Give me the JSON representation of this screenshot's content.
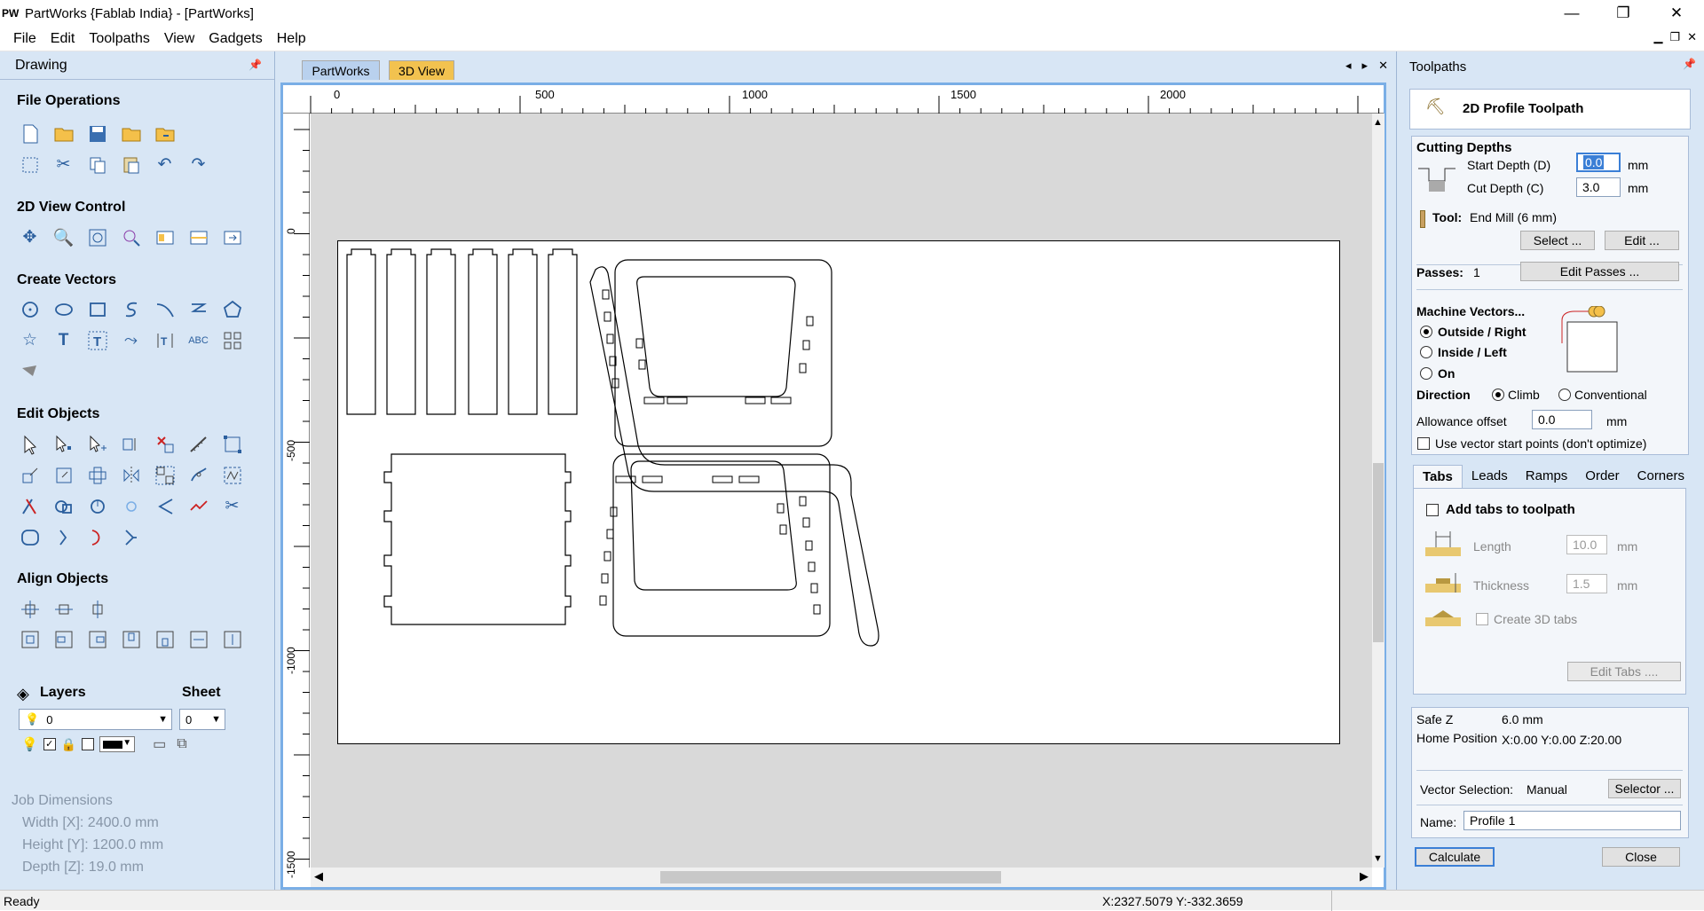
{
  "window": {
    "logo": "PW",
    "title": "PartWorks {Fablab India} - [PartWorks]",
    "minimize": "—",
    "restore": "❐",
    "close": "✕"
  },
  "menu": [
    "File",
    "Edit",
    "Toolpaths",
    "View",
    "Gadgets",
    "Help"
  ],
  "drawing_panel": {
    "title": "Drawing",
    "sections": {
      "file_ops": "File Operations",
      "view_control": "2D View Control",
      "create_vectors": "Create Vectors",
      "edit_objects": "Edit Objects",
      "align_objects": "Align Objects"
    },
    "layers_label": "Layers",
    "sheet_label": "Sheet",
    "layer_value": "0",
    "sheet_value": "0",
    "job_dimensions": {
      "title": "Job Dimensions",
      "width": "Width  [X]: 2400.0 mm",
      "height": "Height [Y]: 1200.0 mm",
      "depth": "Depth  [Z]: 19.0 mm"
    }
  },
  "document": {
    "tabs": [
      "PartWorks",
      "3D View"
    ],
    "hruler_labels": [
      "0",
      "500",
      "1000",
      "1500",
      "2000"
    ],
    "vruler_labels": [
      "0",
      "-500",
      "-1000",
      "-1500"
    ]
  },
  "toolpaths_panel": {
    "title": "Toolpaths",
    "header": "2D Profile Toolpath",
    "cutting_depths": "Cutting Depths",
    "start_depth_label": "Start Depth (D)",
    "start_depth": "0.0",
    "cut_depth_label": "Cut Depth (C)",
    "cut_depth": "3.0",
    "unit": "mm",
    "tool_label": "Tool:",
    "tool_value": "End Mill (6 mm)",
    "select_btn": "Select ...",
    "edit_btn": "Edit ...",
    "passes_label": "Passes:",
    "passes_value": "1",
    "edit_passes_btn": "Edit Passes ...",
    "machine_vectors": "Machine Vectors...",
    "outside": "Outside / Right",
    "inside": "Inside / Left",
    "on": "On",
    "direction": "Direction",
    "climb": "Climb",
    "conventional": "Conventional",
    "allowance_label": "Allowance offset",
    "allowance_value": "0.0",
    "vector_start": "Use vector start points (don't optimize)",
    "subtabs": [
      "Tabs",
      "Leads",
      "Ramps",
      "Order",
      "Corners"
    ],
    "add_tabs": "Add tabs to toolpath",
    "length_label": "Length",
    "length_value": "10.0",
    "thickness_label": "Thickness",
    "thickness_value": "1.5",
    "create_3d": "Create 3D tabs",
    "edit_tabs_btn": "Edit Tabs ....",
    "safe_z_label": "Safe Z",
    "safe_z_value": "6.0 mm",
    "home_label": "Home Position",
    "home_value": "X:0.00 Y:0.00 Z:20.00",
    "vector_selection_label": "Vector Selection:",
    "vector_selection_value": "Manual",
    "selector_btn": "Selector ...",
    "name_label": "Name:",
    "name_value": "Profile 1",
    "calculate_btn": "Calculate",
    "close_btn": "Close"
  },
  "status": {
    "left": "Ready",
    "coords": "X:2327.5079 Y:-332.3659"
  }
}
